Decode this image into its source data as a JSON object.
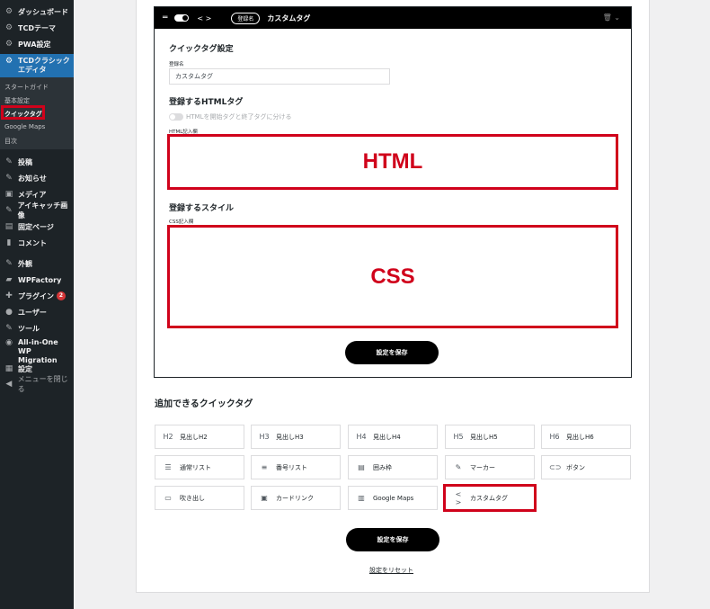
{
  "sidebar": {
    "items": [
      {
        "icon": "dashboard-icon",
        "glyph": "⚙",
        "label": "ダッシュボード"
      },
      {
        "icon": "gear-icon",
        "glyph": "⚙",
        "label": "TCDテーマ"
      },
      {
        "icon": "gear-icon",
        "glyph": "⚙",
        "label": "PWA設定"
      },
      {
        "icon": "gear-icon",
        "glyph": "⚙",
        "label": "TCDクラシックエディタ"
      },
      {
        "icon": "pin-icon",
        "glyph": "✎",
        "label": "投稿"
      },
      {
        "icon": "pin-icon",
        "glyph": "✎",
        "label": "お知らせ"
      },
      {
        "icon": "media-icon",
        "glyph": "▣",
        "label": "メディア"
      },
      {
        "icon": "pin-icon",
        "glyph": "✎",
        "label": "アイキャッチ画像"
      },
      {
        "icon": "page-icon",
        "glyph": "▤",
        "label": "固定ページ"
      },
      {
        "icon": "comment-icon",
        "glyph": "▮",
        "label": "コメント"
      },
      {
        "icon": "brush-icon",
        "glyph": "✎",
        "label": "外観"
      },
      {
        "icon": "wpfactory-icon",
        "glyph": "▰",
        "label": "WPFactory"
      },
      {
        "icon": "plugin-icon",
        "glyph": "✚",
        "label": "プラグイン"
      },
      {
        "icon": "user-icon",
        "glyph": "●",
        "label": "ユーザー"
      },
      {
        "icon": "wrench-icon",
        "glyph": "✎",
        "label": "ツール"
      },
      {
        "icon": "migration-icon",
        "glyph": "◉",
        "label": "All-in-One WP Migration"
      },
      {
        "icon": "settings-icon",
        "glyph": "▦",
        "label": "設定"
      },
      {
        "icon": "collapse-icon",
        "glyph": "◀",
        "label": "メニューを閉じる"
      }
    ],
    "plugin_badge": "2",
    "submenu": [
      "スタートガイド",
      "基本設定",
      "クイックタグ",
      "Google Maps",
      "目次"
    ]
  },
  "editor": {
    "header_badge": "登録名",
    "header_title": "カスタムタグ",
    "section_quicktag": "クイックタグ設定",
    "name_label": "登録名",
    "name_value": "カスタムタグ",
    "section_html": "登録するHTMLタグ",
    "toggle_label": "HTMLを開始タグと終了タグに分ける",
    "html_field_label": "HTML記入欄",
    "html_overlay": "HTML",
    "section_style": "登録するスタイル",
    "css_field_label": "CSS記入欄",
    "css_overlay": "CSS",
    "save_label": "設定を保存"
  },
  "quicktags": {
    "title": "追加できるクイックタグ",
    "buttons": [
      {
        "glyph": "H2",
        "label": "見出しH2",
        "icon": "heading-h2-icon"
      },
      {
        "glyph": "H3",
        "label": "見出しH3",
        "icon": "heading-h3-icon"
      },
      {
        "glyph": "H4",
        "label": "見出しH4",
        "icon": "heading-h4-icon"
      },
      {
        "glyph": "H5",
        "label": "見出しH5",
        "icon": "heading-h5-icon"
      },
      {
        "glyph": "H6",
        "label": "見出しH6",
        "icon": "heading-h6-icon"
      },
      {
        "glyph": "☰",
        "label": "通常リスト",
        "icon": "bullet-list-icon"
      },
      {
        "glyph": "≡",
        "label": "番号リスト",
        "icon": "numbered-list-icon"
      },
      {
        "glyph": "▤",
        "label": "囲み枠",
        "icon": "box-frame-icon"
      },
      {
        "glyph": "✎",
        "label": "マーカー",
        "icon": "marker-icon"
      },
      {
        "glyph": "⊂⊃",
        "label": "ボタン",
        "icon": "link-button-icon"
      },
      {
        "glyph": "▭",
        "label": "吹き出し",
        "icon": "speech-bubble-icon"
      },
      {
        "glyph": "▣",
        "label": "カードリンク",
        "icon": "card-link-icon"
      },
      {
        "glyph": "▥",
        "label": "Google Maps",
        "icon": "map-icon"
      },
      {
        "glyph": "< >",
        "label": "カスタムタグ",
        "icon": "code-icon"
      }
    ],
    "save_label": "設定を保存",
    "reset_label": "設定をリセット"
  },
  "colors": {
    "accent": "#2271b1",
    "highlight": "#d0021b",
    "sidebar_bg": "#1d2327"
  }
}
